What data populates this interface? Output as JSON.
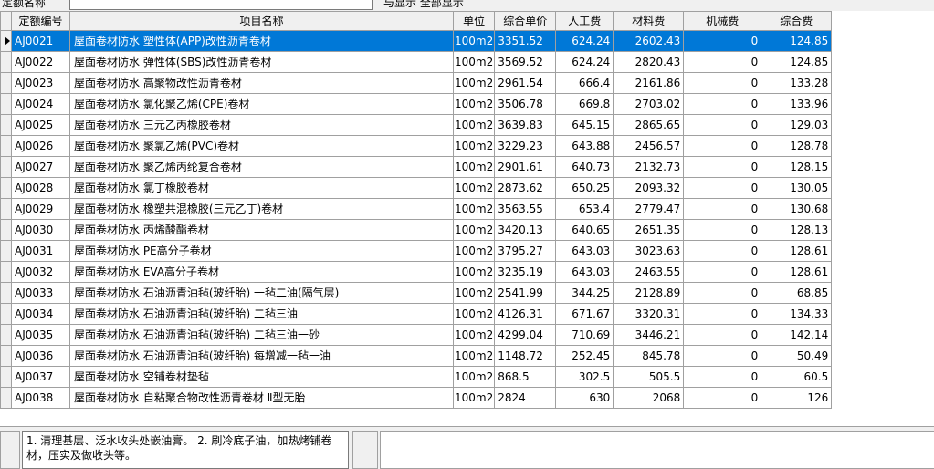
{
  "top": {
    "label": "定额名称",
    "checkbox_text": "与显示   全部显示"
  },
  "columns": {
    "code": "定额编号",
    "name": "项目名称",
    "unit": "单位",
    "unit_price": "综合单价",
    "labor": "人工费",
    "material": "材料费",
    "machine": "机械费",
    "overhead": "综合费"
  },
  "rows": [
    {
      "code": "AJ0021",
      "name": "屋面卷材防水 塑性体(APP)改性沥青卷材",
      "unit": "100m2",
      "unit_price": "3351.52",
      "labor": "624.24",
      "material": "2602.43",
      "machine": "0",
      "overhead": "124.85"
    },
    {
      "code": "AJ0022",
      "name": "屋面卷材防水 弹性体(SBS)改性沥青卷材",
      "unit": "100m2",
      "unit_price": "3569.52",
      "labor": "624.24",
      "material": "2820.43",
      "machine": "0",
      "overhead": "124.85"
    },
    {
      "code": "AJ0023",
      "name": "屋面卷材防水 高聚物改性沥青卷材",
      "unit": "100m2",
      "unit_price": "2961.54",
      "labor": "666.4",
      "material": "2161.86",
      "machine": "0",
      "overhead": "133.28"
    },
    {
      "code": "AJ0024",
      "name": "屋面卷材防水 氯化聚乙烯(CPE)卷材",
      "unit": "100m2",
      "unit_price": "3506.78",
      "labor": "669.8",
      "material": "2703.02",
      "machine": "0",
      "overhead": "133.96"
    },
    {
      "code": "AJ0025",
      "name": "屋面卷材防水 三元乙丙橡胶卷材",
      "unit": "100m2",
      "unit_price": "3639.83",
      "labor": "645.15",
      "material": "2865.65",
      "machine": "0",
      "overhead": "129.03"
    },
    {
      "code": "AJ0026",
      "name": "屋面卷材防水 聚氯乙烯(PVC)卷材",
      "unit": "100m2",
      "unit_price": "3229.23",
      "labor": "643.88",
      "material": "2456.57",
      "machine": "0",
      "overhead": "128.78"
    },
    {
      "code": "AJ0027",
      "name": "屋面卷材防水 聚乙烯丙纶复合卷材",
      "unit": "100m2",
      "unit_price": "2901.61",
      "labor": "640.73",
      "material": "2132.73",
      "machine": "0",
      "overhead": "128.15"
    },
    {
      "code": "AJ0028",
      "name": "屋面卷材防水 氯丁橡胶卷材",
      "unit": "100m2",
      "unit_price": "2873.62",
      "labor": "650.25",
      "material": "2093.32",
      "machine": "0",
      "overhead": "130.05"
    },
    {
      "code": "AJ0029",
      "name": "屋面卷材防水 橡塑共混橡胶(三元乙丁)卷材",
      "unit": "100m2",
      "unit_price": "3563.55",
      "labor": "653.4",
      "material": "2779.47",
      "machine": "0",
      "overhead": "130.68"
    },
    {
      "code": "AJ0030",
      "name": "屋面卷材防水 丙烯酸酯卷材",
      "unit": "100m2",
      "unit_price": "3420.13",
      "labor": "640.65",
      "material": "2651.35",
      "machine": "0",
      "overhead": "128.13"
    },
    {
      "code": "AJ0031",
      "name": "屋面卷材防水 PE高分子卷材",
      "unit": "100m2",
      "unit_price": "3795.27",
      "labor": "643.03",
      "material": "3023.63",
      "machine": "0",
      "overhead": "128.61"
    },
    {
      "code": "AJ0032",
      "name": "屋面卷材防水 EVA高分子卷材",
      "unit": "100m2",
      "unit_price": "3235.19",
      "labor": "643.03",
      "material": "2463.55",
      "machine": "0",
      "overhead": "128.61"
    },
    {
      "code": "AJ0033",
      "name": "屋面卷材防水 石油沥青油毡(玻纤胎) 一毡二油(隔气层)",
      "unit": "100m2",
      "unit_price": "2541.99",
      "labor": "344.25",
      "material": "2128.89",
      "machine": "0",
      "overhead": "68.85"
    },
    {
      "code": "AJ0034",
      "name": "屋面卷材防水 石油沥青油毡(玻纤胎) 二毡三油",
      "unit": "100m2",
      "unit_price": "4126.31",
      "labor": "671.67",
      "material": "3320.31",
      "machine": "0",
      "overhead": "134.33"
    },
    {
      "code": "AJ0035",
      "name": "屋面卷材防水 石油沥青油毡(玻纤胎) 二毡三油一砂",
      "unit": "100m2",
      "unit_price": "4299.04",
      "labor": "710.69",
      "material": "3446.21",
      "machine": "0",
      "overhead": "142.14"
    },
    {
      "code": "AJ0036",
      "name": "屋面卷材防水 石油沥青油毡(玻纤胎) 每增减一毡一油",
      "unit": "100m2",
      "unit_price": "1148.72",
      "labor": "252.45",
      "material": "845.78",
      "machine": "0",
      "overhead": "50.49"
    },
    {
      "code": "AJ0037",
      "name": "屋面卷材防水 空铺卷材垫毡",
      "unit": "100m2",
      "unit_price": "868.5",
      "labor": "302.5",
      "material": "505.5",
      "machine": "0",
      "overhead": "60.5"
    },
    {
      "code": "AJ0038",
      "name": "屋面卷材防水 自粘聚合物改性沥青卷材 Ⅱ型无胎",
      "unit": "100m2",
      "unit_price": "2824",
      "labor": "630",
      "material": "2068",
      "machine": "0",
      "overhead": "126"
    }
  ],
  "selected_index": 0,
  "memo": {
    "text": "1. 清理基层、泛水收头处嵌油膏。  2. 刷冷底子油，加热烤铺卷材，压实及做收头等。"
  },
  "colors": {
    "selection": "#0078d7",
    "grid_line": "#a0a0a0",
    "panel": "#f0f0f0"
  }
}
